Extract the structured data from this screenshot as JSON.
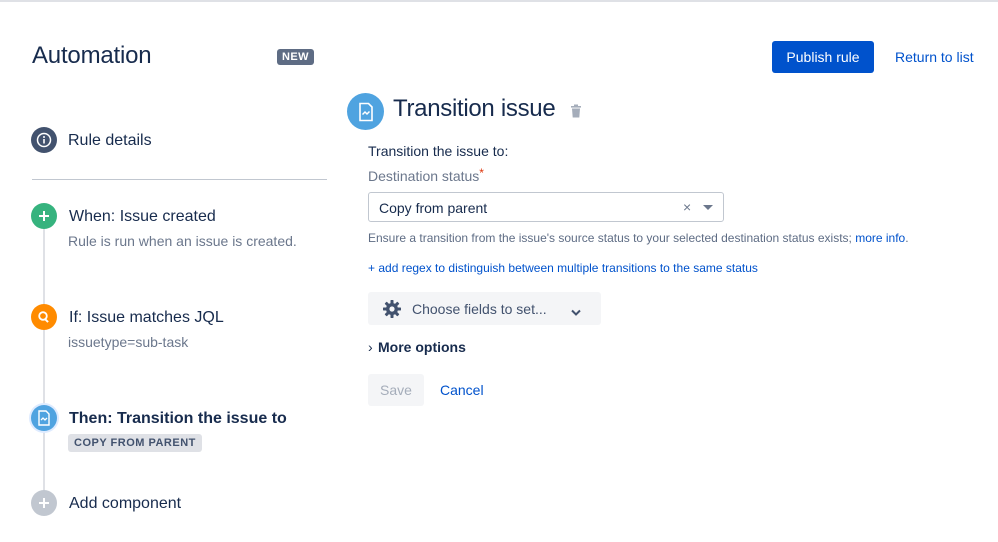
{
  "header": {
    "title": "Automation",
    "badge": "NEW",
    "publish_label": "Publish rule",
    "return_label": "Return to list"
  },
  "sidebar": {
    "rule_details": {
      "label": "Rule details",
      "icon": "info-icon"
    },
    "steps": [
      {
        "title": "When: Issue created",
        "subtitle": "Rule is run when an issue is created.",
        "icon": "plus-icon",
        "color": "#36b37e"
      },
      {
        "title": "If: Issue matches JQL",
        "subtitle": "issuetype=sub-task",
        "icon": "search-icon",
        "color": "#ff8b00"
      },
      {
        "title": "Then: Transition the issue to",
        "chip": "COPY FROM PARENT",
        "icon": "transition-icon",
        "color": "#4fa3e0"
      },
      {
        "title": "Add component",
        "icon": "plus-icon",
        "color": "#c1c7d0"
      }
    ]
  },
  "panel": {
    "title": "Transition issue",
    "section_label": "Transition the issue to:",
    "field_label": "Destination status",
    "required_mark": "*",
    "select_value": "Copy from parent",
    "clear_glyph": "×",
    "help_text": "Ensure a transition from the issue's source status to your selected destination status exists; ",
    "help_link": "more info",
    "help_period": ".",
    "regex_link": "+ add regex to distinguish between multiple transitions to the same status",
    "fields_button": "Choose fields to set...",
    "more_options": "More options",
    "more_chevron": "›",
    "save_label": "Save",
    "cancel_label": "Cancel"
  },
  "colors": {
    "primary": "#0052cc",
    "text": "#172b4d",
    "subtle": "#6b778c",
    "info_icon": "#42526e"
  }
}
